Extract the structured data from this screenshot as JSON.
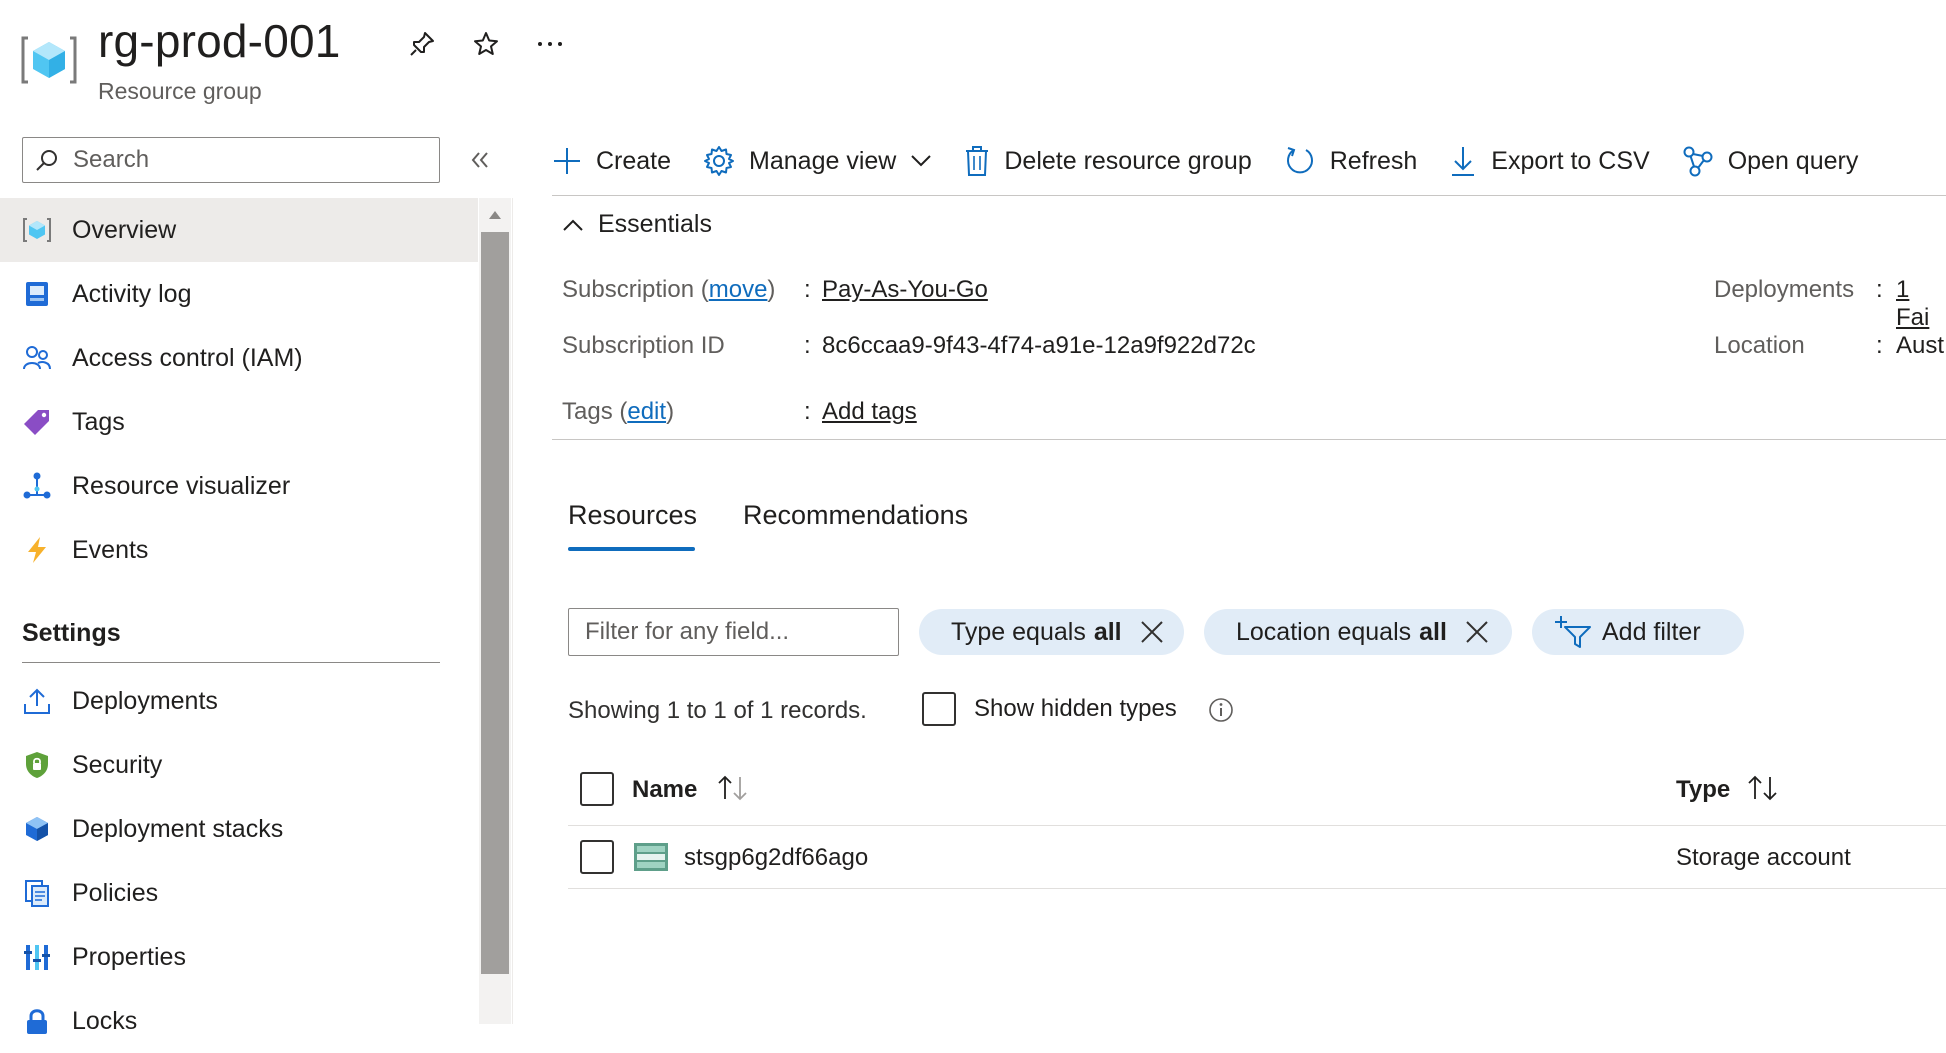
{
  "header": {
    "title": "rg-prod-001",
    "subtitle": "Resource group"
  },
  "sidebar": {
    "search_placeholder": "Search",
    "items": [
      {
        "label": "Overview",
        "icon": "resource-group-icon"
      },
      {
        "label": "Activity log",
        "icon": "activity-log-icon"
      },
      {
        "label": "Access control (IAM)",
        "icon": "people-icon"
      },
      {
        "label": "Tags",
        "icon": "tag-icon"
      },
      {
        "label": "Resource visualizer",
        "icon": "visualizer-icon"
      },
      {
        "label": "Events",
        "icon": "lightning-icon"
      }
    ],
    "settings_label": "Settings",
    "settings_items": [
      {
        "label": "Deployments",
        "icon": "upload-icon"
      },
      {
        "label": "Security",
        "icon": "shield-icon"
      },
      {
        "label": "Deployment stacks",
        "icon": "cube-stack-icon"
      },
      {
        "label": "Policies",
        "icon": "policy-icon"
      },
      {
        "label": "Properties",
        "icon": "properties-icon"
      },
      {
        "label": "Locks",
        "icon": "lock-icon"
      }
    ]
  },
  "toolbar": {
    "create": "Create",
    "manage_view": "Manage view",
    "delete": "Delete resource group",
    "refresh": "Refresh",
    "export": "Export to CSV",
    "open_query": "Open query"
  },
  "essentials": {
    "heading": "Essentials",
    "subscription_label": "Subscription (",
    "subscription_move": "move",
    "subscription_label_end": ")",
    "subscription_value": "Pay-As-You-Go",
    "subscription_id_label": "Subscription ID",
    "subscription_id_value": "8c6ccaa9-9f43-4f74-a91e-12a9f922d72c",
    "tags_label": "Tags (",
    "tags_edit": "edit",
    "tags_label_end": ")",
    "tags_value": "Add tags",
    "deployments_label": "Deployments",
    "deployments_value": "1 Fai",
    "location_label": "Location",
    "location_value": "Aust",
    "colon": ":"
  },
  "tabs": {
    "resources": "Resources",
    "recommendations": "Recommendations"
  },
  "filters": {
    "placeholder": "Filter for any field...",
    "type_prefix": "Type equals",
    "type_value": "all",
    "location_prefix": "Location equals",
    "location_value": "all",
    "add_filter": "Add filter"
  },
  "records_text": "Showing 1 to 1 of 1 records.",
  "show_hidden_label": "Show hidden types",
  "table": {
    "col_name": "Name",
    "col_type": "Type",
    "rows": [
      {
        "name": "stsgp6g2df66ago",
        "type": "Storage account",
        "icon": "storage-account-icon"
      }
    ]
  },
  "colors": {
    "accent": "#0f6cbd",
    "pill_bg": "#e1ecf7",
    "selected_bg": "#edebe9"
  }
}
